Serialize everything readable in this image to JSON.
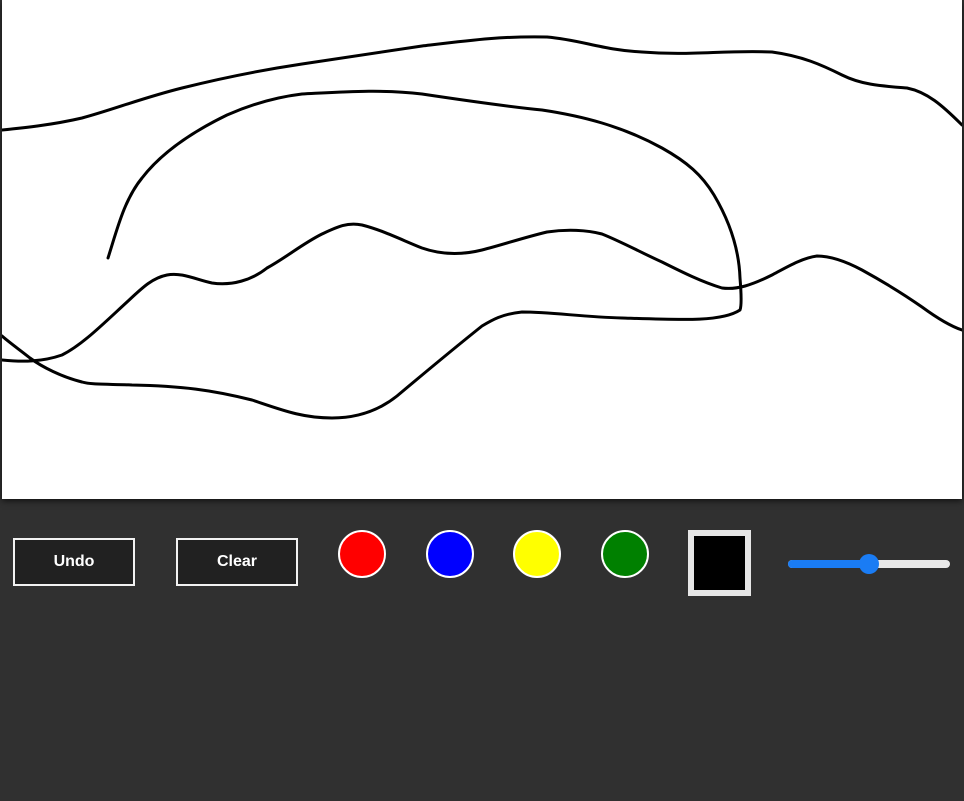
{
  "toolbar": {
    "undo_label": "Undo",
    "clear_label": "Clear",
    "colors": {
      "red": "#ff0000",
      "blue": "#0000ff",
      "yellow": "#ffff00",
      "green": "#008000"
    },
    "current_color": "#000000",
    "brush_size": {
      "value_fraction": 0.5,
      "accent_color": "#1a7cf4"
    }
  },
  "canvas": {
    "background": "#ffffff",
    "stroke_color": "#000000",
    "stroke_count": 5
  }
}
